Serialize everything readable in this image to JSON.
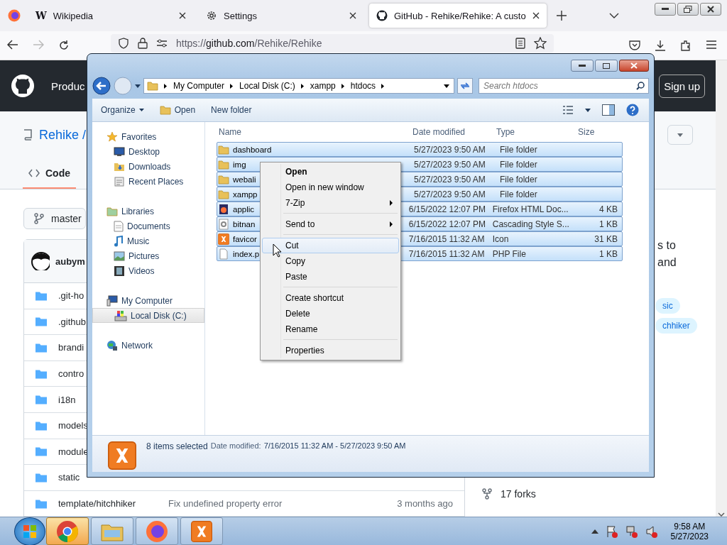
{
  "browser": {
    "tabs": [
      {
        "kind": "wiki",
        "icon_text": "W",
        "title": "Wikipedia",
        "selected": false
      },
      {
        "kind": "settings",
        "title": "Settings",
        "selected": false
      },
      {
        "kind": "github",
        "title": "GitHub - Rehike/Rehike: A custo",
        "selected": true
      }
    ],
    "url": {
      "scheme": "https://",
      "host": "github.com",
      "path": "/Rehike/Rehike"
    }
  },
  "github": {
    "nav_text": "Produc",
    "signup": "Sign up",
    "repo": "Rehike /",
    "code_tab": "Code",
    "branch": "master",
    "commit_author": "aubym",
    "files": [
      {
        "name": ".git-ho"
      },
      {
        "name": ".github"
      },
      {
        "name": "brandi"
      },
      {
        "name": "contro"
      },
      {
        "name": "i18n"
      },
      {
        "name": "models"
      },
      {
        "name": "module"
      },
      {
        "name": "static"
      },
      {
        "name": "template/hitchhiker",
        "message": "Fix undefined property error",
        "age": "3 months ago"
      }
    ],
    "about_lines": [
      "s to",
      "and"
    ],
    "topics": [
      "sic",
      "chhiker"
    ],
    "forks": "17 forks"
  },
  "explorer": {
    "breadcrumb": [
      "My Computer",
      "Local Disk (C:)",
      "xampp",
      "htdocs"
    ],
    "search": {
      "placeholder": "Search htdocs"
    },
    "toolbar": [
      {
        "kind": "menu",
        "label": "Organize"
      },
      {
        "kind": "open",
        "label": "Open"
      },
      {
        "kind": "plain",
        "label": "New folder"
      }
    ],
    "nav": [
      {
        "kind": "favorites",
        "label": "Favorites",
        "selected": false,
        "children": [
          {
            "kind": "desktop",
            "label": "Desktop",
            "selected": false
          },
          {
            "kind": "downloads",
            "label": "Downloads",
            "selected": false
          },
          {
            "kind": "recent",
            "label": "Recent Places",
            "selected": false
          }
        ]
      },
      {
        "kind": "libraries",
        "label": "Libraries",
        "selected": false,
        "children": [
          {
            "kind": "documents",
            "label": "Documents",
            "selected": false
          },
          {
            "kind": "music",
            "label": "Music",
            "selected": false
          },
          {
            "kind": "pictures",
            "label": "Pictures",
            "selected": false
          },
          {
            "kind": "videos",
            "label": "Videos",
            "selected": false
          }
        ]
      },
      {
        "kind": "computer",
        "label": "My Computer",
        "selected": false,
        "children": [
          {
            "kind": "disk",
            "label": "Local Disk (C:)",
            "selected": true
          }
        ]
      },
      {
        "kind": "network",
        "label": "Network",
        "selected": false
      }
    ],
    "columns": [
      "Name",
      "Date modified",
      "Type",
      "Size"
    ],
    "files": [
      {
        "kind": "folder",
        "name": "dashboard",
        "date": "5/27/2023 9:50 AM",
        "type": "File folder",
        "selected": true
      },
      {
        "kind": "folder",
        "name": "img",
        "date": "5/27/2023 9:50 AM",
        "type": "File folder",
        "selected": true
      },
      {
        "kind": "folder",
        "name": "webali",
        "date": "5/27/2023 9:50 AM",
        "type": "File folder",
        "selected": true
      },
      {
        "kind": "folder",
        "name": "xampp",
        "date": "5/27/2023 9:50 AM",
        "type": "File folder",
        "selected": true
      },
      {
        "kind": "html",
        "name": "applic",
        "date": "6/15/2022 12:07 PM",
        "type": "Firefox HTML Doc...",
        "size": "4 KB",
        "selected": true
      },
      {
        "kind": "css",
        "name": "bitnan",
        "date": "6/15/2022 12:07 PM",
        "type": "Cascading Style S...",
        "size": "1 KB",
        "selected": true
      },
      {
        "kind": "ico",
        "name": "favicor",
        "date": "7/16/2015 11:32 AM",
        "type": "Icon",
        "size": "31 KB",
        "selected": true
      },
      {
        "kind": "php",
        "name": "index.p",
        "date": "7/16/2015 11:32 AM",
        "type": "PHP File",
        "size": "1 KB",
        "selected": true
      }
    ],
    "status": {
      "count": "8 items selected",
      "date_label": "Date modified:",
      "date_range": "7/16/2015 11:32 AM - 5/27/2023 9:50 AM"
    }
  },
  "context_menu": [
    {
      "kind": "item",
      "label": "Open",
      "default": true,
      "submenu": false,
      "selected": false
    },
    {
      "kind": "item",
      "label": "Open in new window",
      "default": false,
      "submenu": false,
      "selected": false
    },
    {
      "kind": "item",
      "label": "7-Zip",
      "default": false,
      "submenu": true,
      "selected": false
    },
    {
      "kind": "separator"
    },
    {
      "kind": "item",
      "label": "Send to",
      "default": false,
      "submenu": true,
      "selected": false
    },
    {
      "kind": "separator"
    },
    {
      "kind": "item",
      "label": "Cut",
      "default": false,
      "submenu": false,
      "selected": true
    },
    {
      "kind": "item",
      "label": "Copy",
      "default": false,
      "submenu": false,
      "selected": false
    },
    {
      "kind": "item",
      "label": "Paste",
      "default": false,
      "submenu": false,
      "selected": false
    },
    {
      "kind": "separator"
    },
    {
      "kind": "item",
      "label": "Create shortcut",
      "default": false,
      "submenu": false,
      "selected": false
    },
    {
      "kind": "item",
      "label": "Delete",
      "default": false,
      "submenu": false,
      "selected": false
    },
    {
      "kind": "item",
      "label": "Rename",
      "default": false,
      "submenu": false,
      "selected": false
    },
    {
      "kind": "separator"
    },
    {
      "kind": "item",
      "label": "Properties",
      "default": false,
      "submenu": false,
      "selected": false
    }
  ],
  "taskbar": {
    "apps": [
      {
        "kind": "chrome",
        "highlighted": true
      },
      {
        "kind": "explorer",
        "highlighted": false
      },
      {
        "kind": "firefox",
        "highlighted": false
      },
      {
        "kind": "xampp",
        "highlighted": false
      }
    ],
    "time": "9:58 AM",
    "date": "5/27/2023"
  }
}
